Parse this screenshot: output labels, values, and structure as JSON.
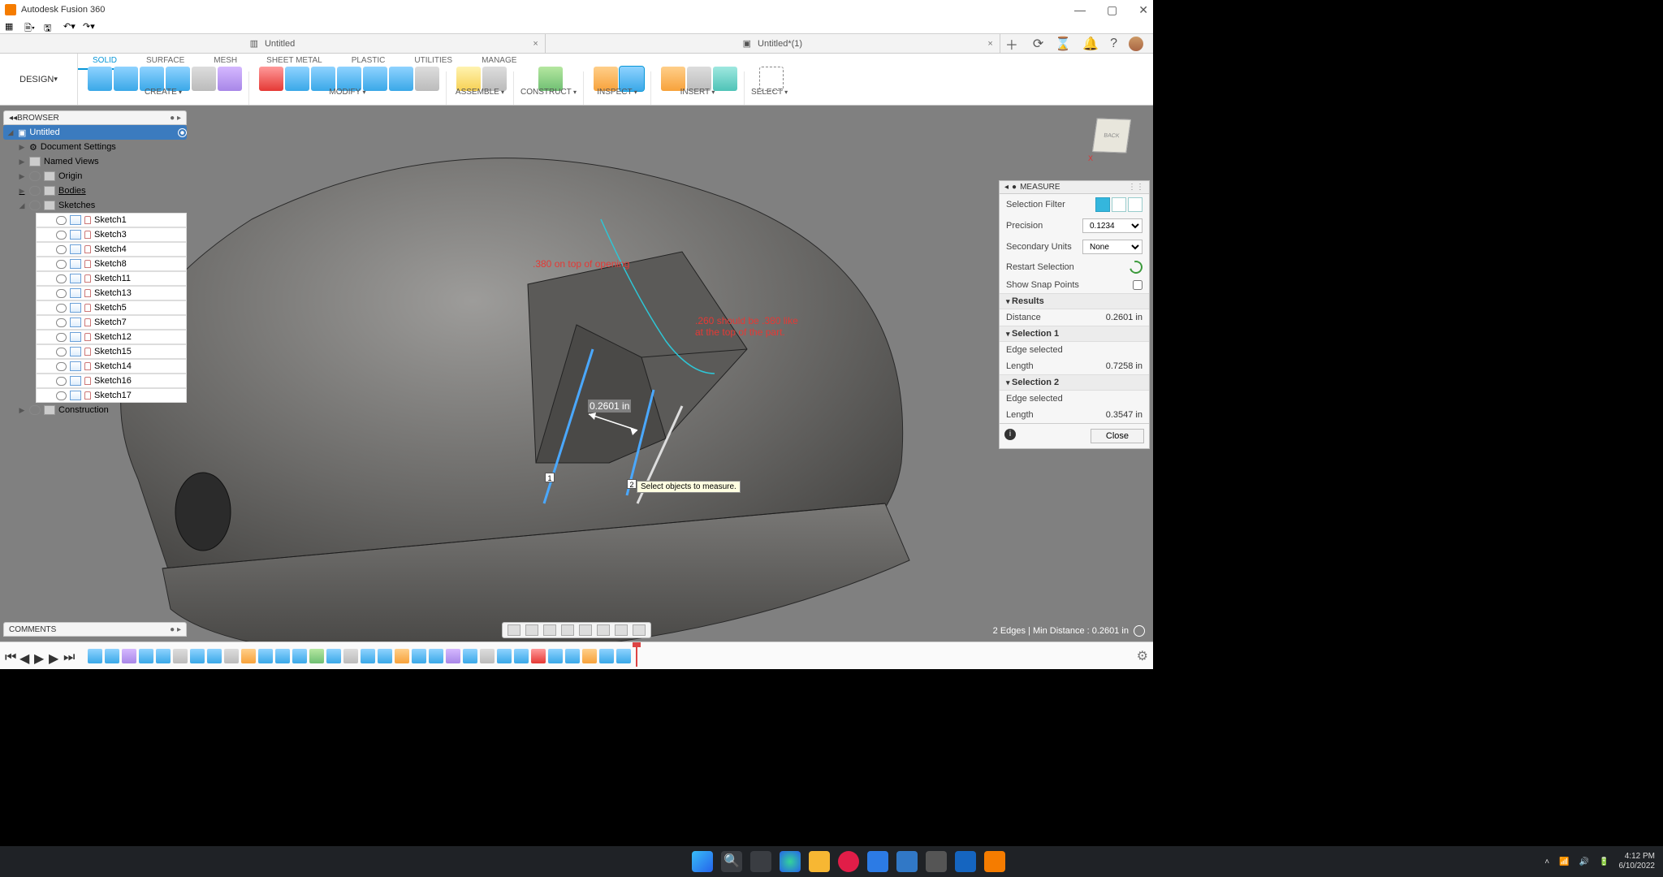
{
  "app": {
    "title": "Autodesk Fusion 360"
  },
  "doctabs": {
    "tab1": "Untitled",
    "tab2": "Untitled*(1)"
  },
  "workspace": "DESIGN",
  "ribtabs": {
    "solid": "SOLID",
    "surface": "SURFACE",
    "mesh": "MESH",
    "sheetmetal": "SHEET METAL",
    "plastic": "PLASTIC",
    "utilities": "UTILITIES",
    "manage": "MANAGE"
  },
  "tg": {
    "create": "CREATE",
    "modify": "MODIFY",
    "assemble": "ASSEMBLE",
    "construct": "CONSTRUCT",
    "inspect": "INSPECT",
    "insert": "INSERT",
    "select": "SELECT"
  },
  "browser": {
    "title": "BROWSER",
    "root": "Untitled",
    "docset": "Document Settings",
    "named": "Named Views",
    "origin": "Origin",
    "bodies": "Bodies",
    "sketches": "Sketches",
    "construction": "Construction",
    "items": [
      "Sketch1",
      "Sketch3",
      "Sketch4",
      "Sketch8",
      "Sketch11",
      "Sketch13",
      "Sketch5",
      "Sketch7",
      "Sketch12",
      "Sketch15",
      "Sketch14",
      "Sketch16",
      "Sketch17"
    ]
  },
  "comments": "COMMENTS",
  "measure": {
    "title": "MEASURE",
    "selfilter": "Selection Filter",
    "precision": "Precision",
    "precision_val": "0.1234",
    "secunits": "Secondary Units",
    "secunits_val": "None",
    "restart": "Restart Selection",
    "snap": "Show Snap Points",
    "results": "Results",
    "distance_lbl": "Distance",
    "distance_val": "0.2601 in",
    "sel1": "Selection 1",
    "sel2": "Selection 2",
    "edge": "Edge selected",
    "len_lbl": "Length",
    "len1": "0.7258 in",
    "len2": "0.3547 in",
    "close": "Close"
  },
  "canvas": {
    "anno1": ".380 on top of opening",
    "anno2": ".260 should be .380 like at the top of the part.",
    "dim": "0.2601 in",
    "tip": "Select objects to measure.",
    "tag1": "1",
    "tag2": "2",
    "cubeface": "BACK"
  },
  "status": "2 Edges | Min Distance : 0.2601 in",
  "tray": {
    "time": "4:12 PM",
    "date": "6/10/2022"
  }
}
